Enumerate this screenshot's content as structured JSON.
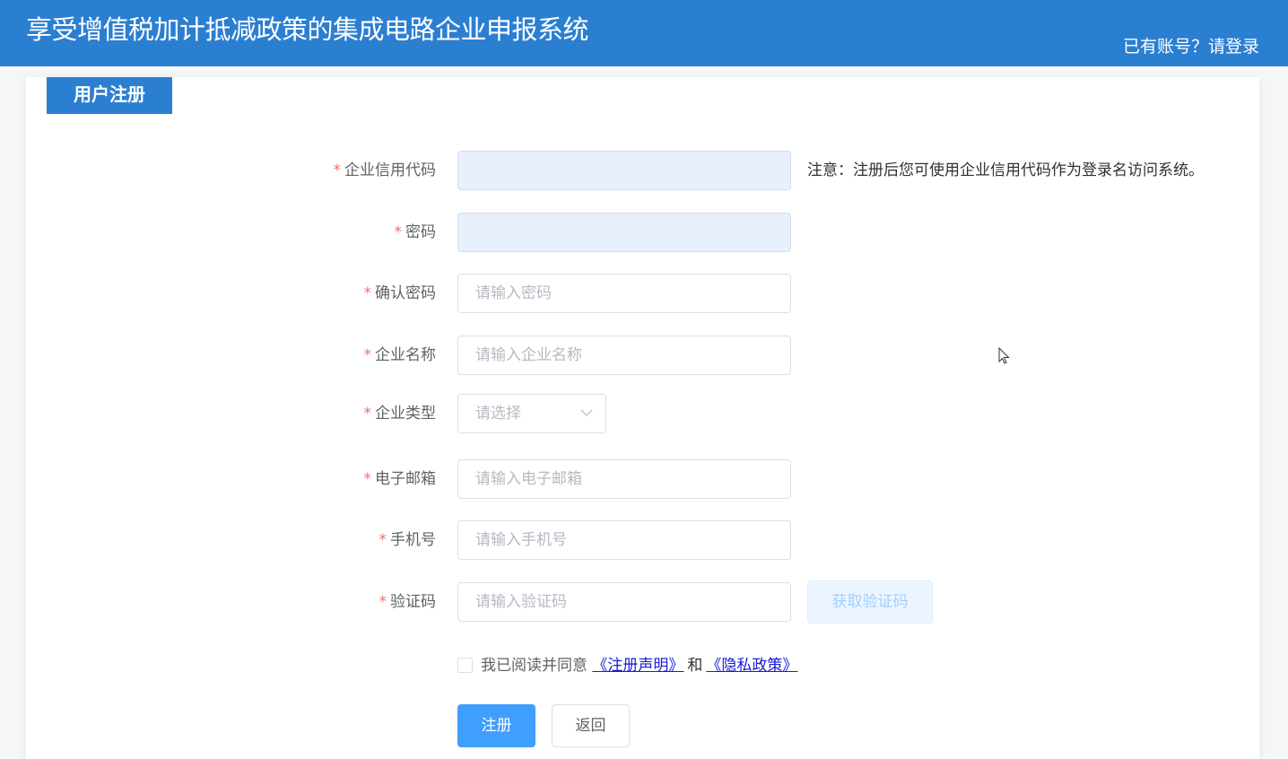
{
  "header": {
    "title": "享受增值税加计抵减政策的集成电路企业申报系统",
    "login_link": "已有账号？请登录"
  },
  "card": {
    "tag": "用户注册"
  },
  "form": {
    "required_mark": "*",
    "credit_code": {
      "label": "企业信用代码",
      "value": "",
      "note": "注意：注册后您可使用企业信用代码作为登录名访问系统。"
    },
    "password": {
      "label": "密码",
      "value": ""
    },
    "confirm_password": {
      "label": "确认密码",
      "placeholder": "请输入密码"
    },
    "company_name": {
      "label": "企业名称",
      "placeholder": "请输入企业名称"
    },
    "company_type": {
      "label": "企业类型",
      "placeholder": "请选择"
    },
    "email": {
      "label": "电子邮箱",
      "placeholder": "请输入电子邮箱"
    },
    "phone": {
      "label": "手机号",
      "placeholder": "请输入手机号"
    },
    "verify_code": {
      "label": "验证码",
      "placeholder": "请输入验证码",
      "button": "获取验证码"
    },
    "agreement": {
      "prefix": "我已阅读并同意",
      "terms_link": "《注册声明》",
      "and": "和",
      "privacy_link": "《隐私政策》"
    },
    "submit_label": "注册",
    "back_label": "返回"
  },
  "colors": {
    "header_bg": "#2b7fd1",
    "primary": "#409eff",
    "required": "#f56c6c",
    "link": "#1a1ad6"
  }
}
